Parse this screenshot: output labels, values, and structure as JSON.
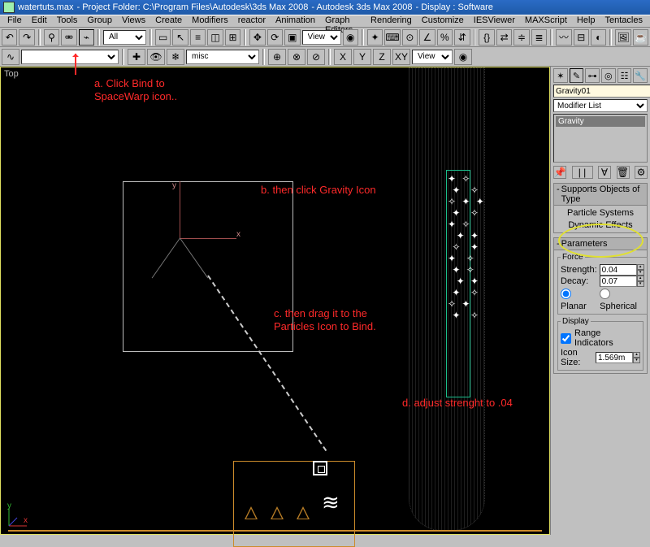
{
  "title": {
    "file": "watertuts.max",
    "project": "- Project Folder: C:\\Program Files\\Autodesk\\3ds Max 2008",
    "app": "-       Autodesk 3ds Max 2008",
    "display": "-   Display : Software"
  },
  "menu": [
    "File",
    "Edit",
    "Tools",
    "Group",
    "Views",
    "Create",
    "Modifiers",
    "reactor",
    "Animation",
    "Graph Editors",
    "Rendering",
    "Customize",
    "IESViewer",
    "MAXScript",
    "Help",
    "Tentacles"
  ],
  "toolbar": {
    "filter": "All",
    "view_a": "View",
    "view_b": "View",
    "layer": "misc"
  },
  "viewport": {
    "label": "Top"
  },
  "annot": {
    "a": "a. Click Bind to\nSpaceWarp icon..",
    "b": "b. then click Gravity Icon",
    "c": "c. then drag it to the\nParticles Icon to Bind.",
    "d": "d. adjust strenght to .04"
  },
  "gravity": {
    "y": "y",
    "x": "x"
  },
  "panel": {
    "objname": "Gravity01",
    "modlist": "Modifier List",
    "stack_item": "Gravity",
    "supports_hdr": "Supports Objects of Type",
    "supports_1": "Particle Systems",
    "supports_2": "Dynamic Effects",
    "params_hdr": "Parameters",
    "force_legend": "Force",
    "strength_label": "Strength:",
    "strength_value": "0.04",
    "decay_label": "Decay:",
    "decay_value": "0.07",
    "type_planar": "Planar",
    "type_spherical": "Spherical",
    "display_legend": "Display",
    "range_label": "Range Indicators",
    "iconsize_label": "Icon Size:",
    "iconsize_value": "1.569m"
  },
  "axes": {
    "x": "x",
    "y": "y"
  }
}
